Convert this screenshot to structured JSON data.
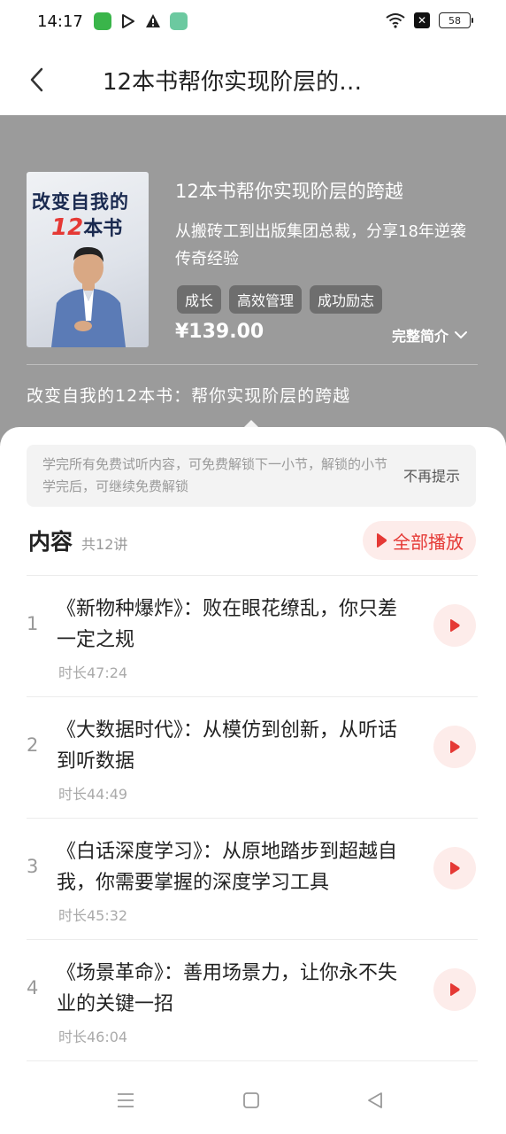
{
  "status": {
    "time": "14:17",
    "battery": "58"
  },
  "nav": {
    "title": "12本书帮你实现阶层的…"
  },
  "book": {
    "cover_text_line1": "改变自我的",
    "cover_text_num": "12",
    "cover_text_rest": "本书",
    "title": "12本书帮你实现阶层的跨越",
    "subtitle": "从搬砖工到出版集团总裁，分享18年逆袭传奇经验",
    "tags": [
      "成长",
      "高效管理",
      "成功励志"
    ],
    "price": "¥139.00",
    "intro_label": "完整简介",
    "series_title": "改变自我的12本书：帮你实现阶层的跨越"
  },
  "tip": {
    "text": "学完所有免费试听内容，可免费解锁下一小节，解锁的小节学完后，可继续免费解锁",
    "dismiss": "不再提示"
  },
  "content": {
    "label": "内容",
    "count": "共12讲",
    "play_all": "全部播放"
  },
  "lessons": [
    {
      "num": "1",
      "title": "《新物种爆炸》：败在眼花缭乱，你只差一定之规",
      "duration": "时长47:24"
    },
    {
      "num": "2",
      "title": "《大数据时代》：从模仿到创新，从听话到听数据",
      "duration": "时长44:49"
    },
    {
      "num": "3",
      "title": "《白话深度学习》：从原地踏步到超越自我，你需要掌握的深度学习工具",
      "duration": "时长45:32"
    },
    {
      "num": "4",
      "title": "《场景革命》：善用场景力，让你永不失业的关键一招",
      "duration": "时长46:04"
    }
  ],
  "colors": {
    "accent": "#e53935",
    "header_bg": "#9b9b9b",
    "play_bg": "#fdecea"
  }
}
